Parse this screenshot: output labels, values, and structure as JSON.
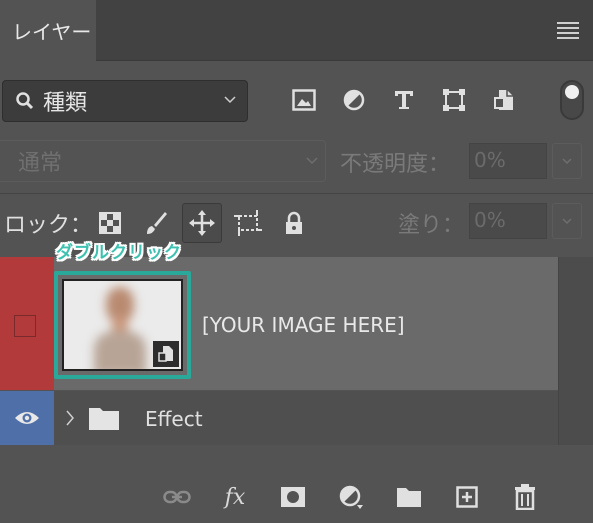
{
  "tabs": [
    {
      "label": "レイヤー"
    }
  ],
  "filter": {
    "kind_label": "種類",
    "icons": [
      "image-filter-icon",
      "adjustment-filter-icon",
      "type-filter-icon",
      "shape-filter-icon",
      "smart-object-filter-icon"
    ]
  },
  "blend": {
    "mode": "通常",
    "opacity_label": "不透明度：",
    "opacity_value": "0%"
  },
  "lock": {
    "label": "ロック：",
    "icons": [
      "lock-transparent-pixels-icon",
      "lock-image-pixels-icon",
      "lock-position-icon",
      "lock-artboard-icon",
      "lock-all-icon"
    ],
    "fill_label": "塗り：",
    "fill_value": "0%"
  },
  "annotation": "ダブルクリック",
  "layers": [
    {
      "name": "[YOUR IMAGE HERE]",
      "type": "smart-object",
      "visible": false,
      "color_label": "#b33a3a"
    },
    {
      "name": "Effect",
      "type": "group",
      "visible": true,
      "color_label": "#4f6fa8"
    }
  ],
  "bottom_toolbar": {
    "fx_label": "fx",
    "icons": [
      "link-layers-icon",
      "layer-style-icon",
      "add-mask-icon",
      "adjustment-layer-icon",
      "new-group-icon",
      "new-layer-icon",
      "delete-layer-icon"
    ]
  },
  "colors": {
    "panel_bg": "#535353",
    "selected_layer": "#6a6a6a",
    "annotation": "#3ec1b1"
  }
}
